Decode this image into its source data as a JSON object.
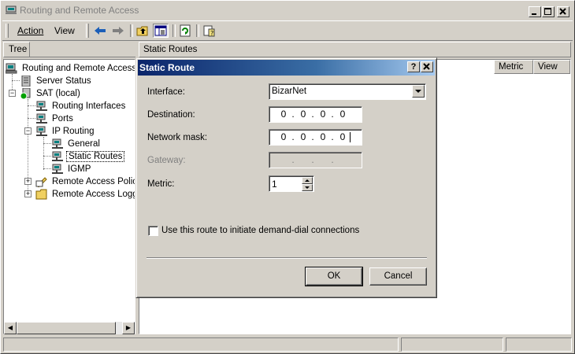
{
  "window": {
    "title": "Routing and Remote Access"
  },
  "menu": {
    "action": "Action",
    "view": "View"
  },
  "left_pane": {
    "header": "Tree",
    "items": [
      {
        "label": "Routing and Remote Access"
      },
      {
        "label": "Server Status"
      },
      {
        "label": "SAT (local)"
      },
      {
        "label": "Routing Interfaces"
      },
      {
        "label": "Ports"
      },
      {
        "label": "IP Routing"
      },
      {
        "label": "General"
      },
      {
        "label": "Static Routes"
      },
      {
        "label": "IGMP"
      },
      {
        "label": "Remote Access Policie"
      },
      {
        "label": "Remote Access Loggin"
      }
    ]
  },
  "right_pane": {
    "header": "Static Routes",
    "columns": [
      "Metric",
      "View"
    ]
  },
  "dialog": {
    "title": "Static Route",
    "interface_label": "Interface:",
    "interface_value": "BizarNet",
    "destination_label": "Destination:",
    "destination": [
      "0",
      "0",
      "0",
      "0"
    ],
    "mask_label": "Network mask:",
    "mask": [
      "0",
      "0",
      "0",
      "0"
    ],
    "gateway_label": "Gateway:",
    "metric_label": "Metric:",
    "metric_value": "1",
    "demand_dial_label": "Use this route to initiate demand-dial connections",
    "ok": "OK",
    "cancel": "Cancel"
  },
  "icons": {
    "help": "?",
    "close": "✕"
  }
}
